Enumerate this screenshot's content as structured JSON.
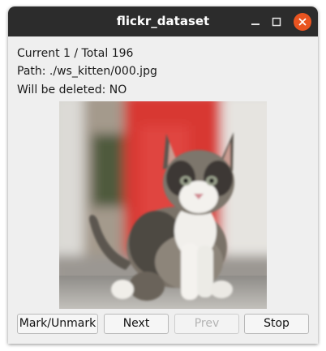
{
  "window": {
    "title": "flickr_dataset",
    "controls": {
      "minimize_icon": "minimize-icon",
      "maximize_icon": "maximize-icon",
      "close_icon": "close-icon",
      "close_color": "#e95420"
    }
  },
  "info": {
    "progress": "Current 1 / Total 196",
    "path": "Path: ./ws_kitten/000.jpg",
    "delete_status": "Will be deleted: NO"
  },
  "buttons": {
    "mark": "Mark/Unmark",
    "next": "Next",
    "prev": "Prev",
    "stop": "Stop"
  }
}
